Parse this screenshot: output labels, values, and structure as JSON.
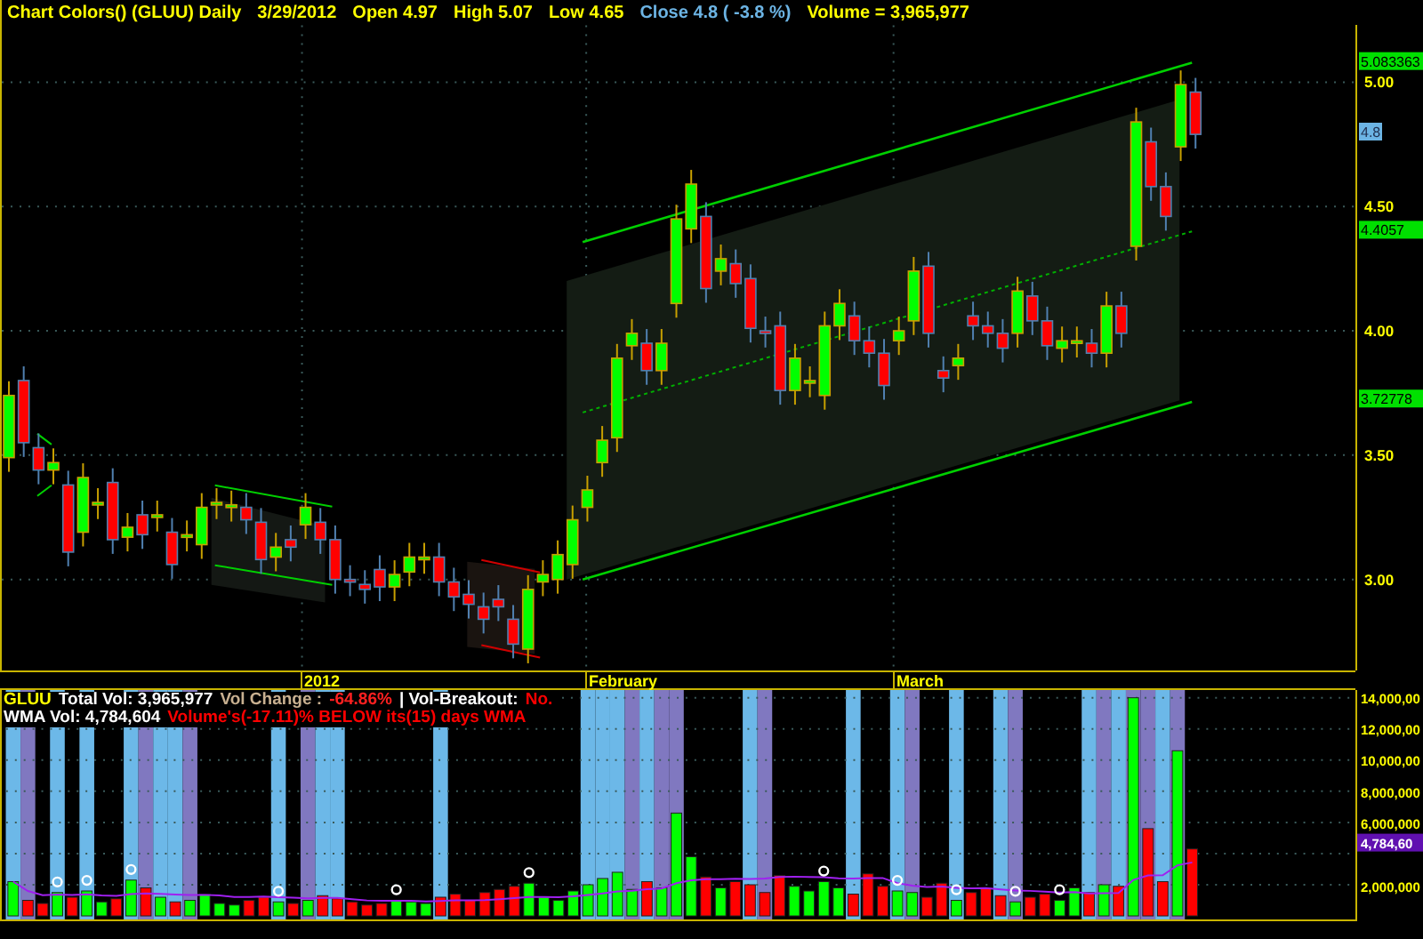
{
  "header": {
    "title": "Chart Colors() (GLUU) Daily",
    "date": "3/29/2012",
    "fields": [
      {
        "text": "Open 4.97",
        "kind": "plain"
      },
      {
        "text": "High 5.07",
        "kind": "plain"
      },
      {
        "text": "Low 4.65",
        "kind": "plain"
      },
      {
        "text": "Close 4.8 ( -3.8 %)",
        "kind": "close"
      },
      {
        "text": "Volume = 3,965,977",
        "kind": "plain"
      }
    ]
  },
  "price_axis": {
    "ticks": [
      "5.00",
      "4.50",
      "4.00",
      "3.50",
      "3.00"
    ],
    "markers": [
      {
        "text": "5.083363",
        "kind": "channel"
      },
      {
        "text": "4.8",
        "kind": "last"
      },
      {
        "text": "4.4057",
        "kind": "channel"
      },
      {
        "text": "3.72778",
        "kind": "channel"
      }
    ]
  },
  "time_axis": {
    "labels": [
      "2012",
      "February",
      "March"
    ]
  },
  "volume_panel": {
    "symbol": "GLUU",
    "total_vol": "Total Vol: 3,965,977",
    "vol_change_label": "Vol Change :",
    "vol_change": "-64.86%",
    "breakout_label": "| Vol-Breakout:",
    "breakout": "No.",
    "wma": "WMA Vol: 4,784,604",
    "wma_note": "Volume's(-17.11)% BELOW its(15) days WMA"
  },
  "volume_axis": {
    "ticks": [
      "14,000,00",
      "12,000,00",
      "10,000,00",
      "8,000,000",
      "6,000,000",
      "2,000,000"
    ],
    "marker": "4,784,60"
  }
}
